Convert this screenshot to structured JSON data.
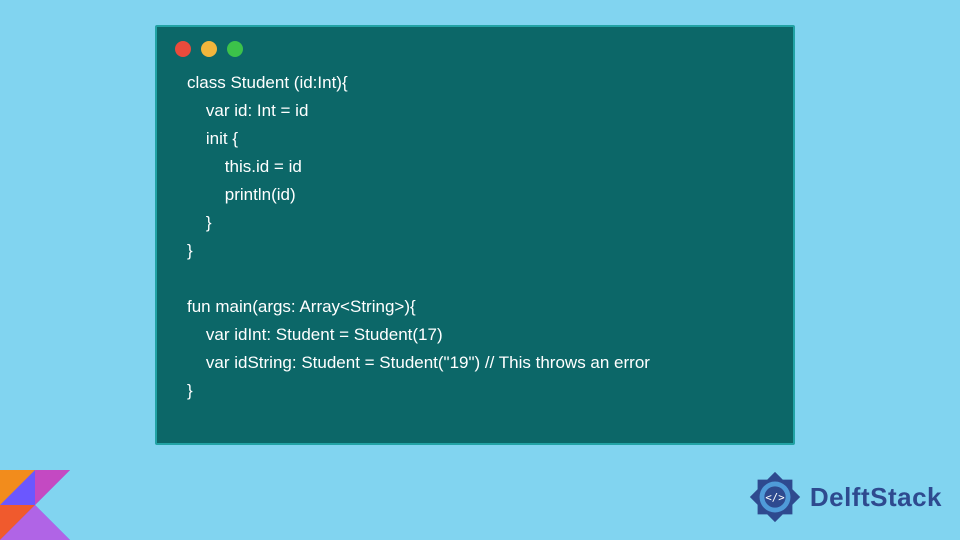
{
  "colors": {
    "page_bg": "#81d4f0",
    "window_bg": "#0c6768",
    "window_border": "#22a3a5",
    "code_text": "#ffffff",
    "dot_red": "#e94b3c",
    "dot_yellow": "#f2b63c",
    "dot_green": "#3cc24a",
    "brand_text": "#2e4a8f"
  },
  "window": {
    "dots": [
      "red",
      "yellow",
      "green"
    ]
  },
  "code_lines": [
    "class Student (id:Int){",
    "    var id: Int = id",
    "    init {",
    "        this.id = id",
    "        println(id)",
    "    }",
    "}",
    "",
    "fun main(args: Array<String>){",
    "    var idInt: Student = Student(17)",
    "    var idString: Student = Student(\"19\") // This throws an error",
    "}"
  ],
  "brand": {
    "name": "DelftStack"
  },
  "icons": {
    "kotlin": "kotlin-logo",
    "brand_badge": "delftstack-badge"
  }
}
